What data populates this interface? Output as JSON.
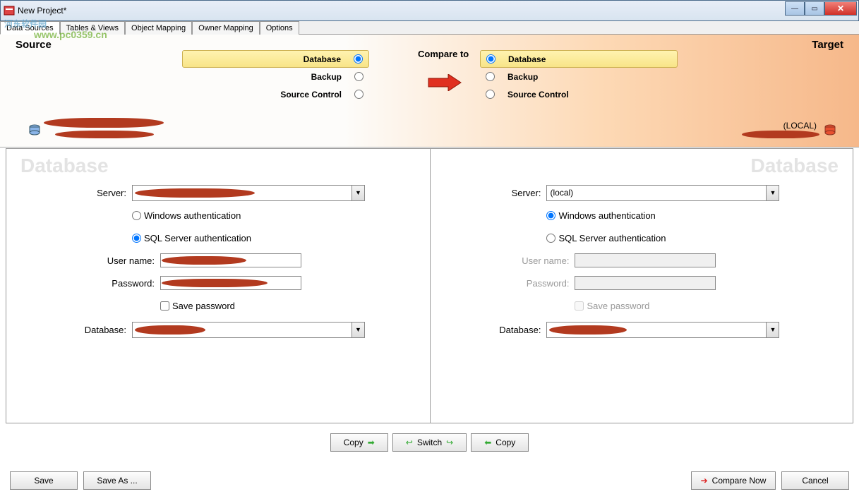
{
  "window": {
    "title": "New Project*"
  },
  "tabs": [
    "Data Sources",
    "Tables & Views",
    "Object Mapping",
    "Owner Mapping",
    "Options"
  ],
  "watermark": {
    "line1": "河东软件园",
    "line2": "www.pc0359.cn"
  },
  "top": {
    "source_label": "Source",
    "target_label": "Target",
    "compare_label": "Compare to",
    "options": {
      "database": "Database",
      "backup": "Backup",
      "source_control": "Source Control"
    },
    "target_server_display": "(LOCAL)"
  },
  "heading": {
    "left": "Database",
    "right": "Database"
  },
  "form": {
    "server_label": "Server:",
    "win_auth": "Windows authentication",
    "sql_auth": "SQL Server authentication",
    "username_label": "User name:",
    "password_label": "Password:",
    "savepwd_label": "Save password",
    "database_label": "Database:",
    "target_server_value": "(local)"
  },
  "buttons": {
    "copy_right": "Copy",
    "switch": "Switch",
    "copy_left": "Copy",
    "save": "Save",
    "save_as": "Save As ...",
    "compare_now": "Compare Now",
    "cancel": "Cancel"
  }
}
